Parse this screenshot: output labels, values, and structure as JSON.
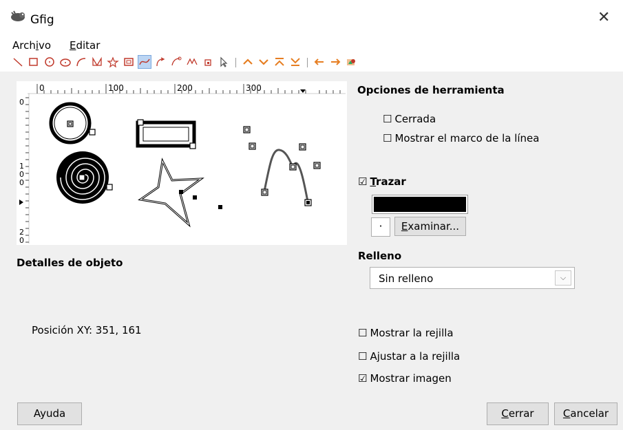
{
  "window": {
    "title": "Gfig",
    "close_glyph": "✕"
  },
  "menu": {
    "archivo_pre": "Arch",
    "archivo_acc": "i",
    "archivo_post": "vo",
    "editar_acc": "E",
    "editar_post": "ditar"
  },
  "toolbar": {
    "tools": [
      "line-tool",
      "rectangle-tool",
      "circle-tool",
      "ellipse-tool",
      "arc-tool",
      "polygon-tool",
      "star-tool",
      "spiral-tool",
      "bezier-tool",
      "move-object-tool",
      "move-point-tool",
      "copy-object-tool",
      "delete-object-tool",
      "select-object-tool"
    ],
    "selected": "bezier-tool",
    "order_buttons": [
      "raise",
      "lower",
      "raise-to-top",
      "lower-to-bottom"
    ],
    "nav_buttons": [
      "show-previous",
      "show-next",
      "show-all"
    ]
  },
  "ruler": {
    "top_labels": [
      "0",
      "100",
      "200",
      "300"
    ],
    "left_labels": [
      "0",
      "1\n0\n0",
      "2\n0"
    ]
  },
  "tool_options": {
    "title": "Opciones de herramienta",
    "closed_label": "Cerrada",
    "closed_checked": false,
    "show_line_frame_label": "Mostrar el marco de la línea",
    "show_line_frame_checked": false
  },
  "stroke": {
    "checked": true,
    "label_acc": "T",
    "label_post": "razar",
    "color": "#000000",
    "brush_dot": "·",
    "browse_pre": "",
    "browse_acc": "E",
    "browse_post": "xaminar..."
  },
  "fill": {
    "title": "Relleno",
    "selected": "Sin relleno"
  },
  "object_details": {
    "title": "Detalles de objeto",
    "position_text": "Posición XY: 351, 161"
  },
  "grid": {
    "show_grid_label": "Mostrar la rejilla",
    "show_grid_checked": false,
    "snap_grid_label": "Ajustar a la rejilla",
    "snap_grid_checked": false,
    "show_image_label": "Mostrar imagen",
    "show_image_checked": true
  },
  "buttons": {
    "help": "Ayuda",
    "close_acc": "C",
    "close_post": "errar",
    "cancel_acc": "C",
    "cancel_post": "ancelar"
  }
}
